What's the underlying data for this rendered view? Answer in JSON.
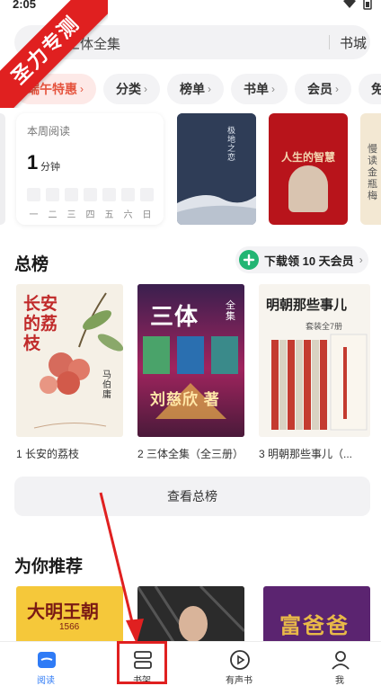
{
  "status_bar": {
    "time": "2:05"
  },
  "watermark": {
    "text": "圣力专测"
  },
  "search": {
    "placeholder": "三体全集",
    "button_label": "书城"
  },
  "chips": [
    {
      "label": "端午特惠",
      "promo": true
    },
    {
      "label": "分类"
    },
    {
      "label": "榜单"
    },
    {
      "label": "书单"
    },
    {
      "label": "会员"
    },
    {
      "label": "免"
    }
  ],
  "weekly_reading": {
    "title": "本周阅读",
    "value": "1",
    "unit": "分钟",
    "days": [
      "一",
      "二",
      "三",
      "四",
      "五",
      "六",
      "日"
    ]
  },
  "recent_covers": [
    {
      "title": "极地之恋",
      "color": "#2f3d57"
    },
    {
      "title": "人生的智慧",
      "color": "#b8141b"
    },
    {
      "title": "慢读金瓶梅",
      "color": "#f3e8d3"
    }
  ],
  "ranking": {
    "title": "总榜",
    "promo_label": "下载领 10 天会员",
    "books": [
      {
        "caption": "1 长安的荔枝",
        "cover_title": "长安的荔枝",
        "author": "马伯庸"
      },
      {
        "caption": "2 三体全集（全三册）",
        "cover_title": "三体",
        "cover_sub": "全集",
        "author": "刘慈欣 著"
      },
      {
        "caption": "3 明朝那些事儿（...",
        "cover_title": "明朝那些事儿",
        "cover_sub": "套装全7册"
      }
    ],
    "view_all_label": "查看总榜"
  },
  "recommend": {
    "title": "为你推荐",
    "covers": [
      {
        "title": "大明王朝",
        "sub": "1566"
      },
      {
        "title": ""
      },
      {
        "title": "富爸爸"
      }
    ]
  },
  "bottom_nav": [
    {
      "label": "阅读",
      "icon": "read-icon",
      "active": true
    },
    {
      "label": "书架",
      "icon": "bookshelf-icon",
      "active": false
    },
    {
      "label": "有声书",
      "icon": "audiobook-icon",
      "active": false
    },
    {
      "label": "我",
      "icon": "profile-icon",
      "active": false
    }
  ],
  "colors": {
    "accent": "#2f7bf6",
    "promo": "#e5533d",
    "annotation": "#e02020",
    "member_green": "#22b573"
  }
}
